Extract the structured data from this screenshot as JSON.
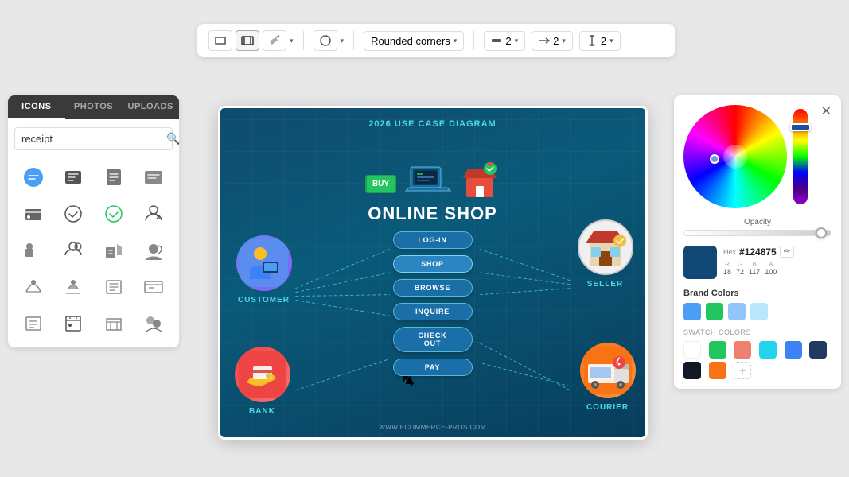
{
  "toolbar": {
    "rounded_corners_label": "Rounded corners",
    "stroke_width_label": "2",
    "arrow_width_label": "2",
    "height_label": "2",
    "chevron": "▾"
  },
  "left_panel": {
    "tabs": [
      "ICONS",
      "PHOTOS",
      "UPLOADS"
    ],
    "active_tab": "ICONS",
    "search_placeholder": "receipt",
    "search_value": "receipt"
  },
  "diagram": {
    "title": "2026 USE CASE DIAGRAM",
    "subtitle": "ONLINE SHOP",
    "url": "WWW.ECOMMERCE-PROS.COM",
    "actors": {
      "customer": "CUSTOMER",
      "seller": "SELLER",
      "bank": "BANK",
      "courier": "COURIER"
    },
    "use_cases": [
      "LOG-IN",
      "SHOP",
      "BROWSE",
      "INQUIRE",
      "CHECK OUT",
      "PAY"
    ]
  },
  "color_panel": {
    "opacity_label": "Opacity",
    "hex_label": "Hex",
    "hex_value": "#124875",
    "r": 18,
    "g": 72,
    "b": 117,
    "a": 100,
    "brand_colors_label": "Brand Colors",
    "swatch_colors_label": "SWATCH COLORS",
    "brand_colors": [
      "#4a9ef5",
      "#22c55e",
      "#93c5fd",
      "#bae6fd"
    ],
    "swatch_colors": [
      "#ffffff",
      "#22c55e",
      "#ef8070",
      "#22d3ee",
      "#3b82f6",
      "#1e3a5f",
      "#111827",
      "#f97316"
    ]
  }
}
